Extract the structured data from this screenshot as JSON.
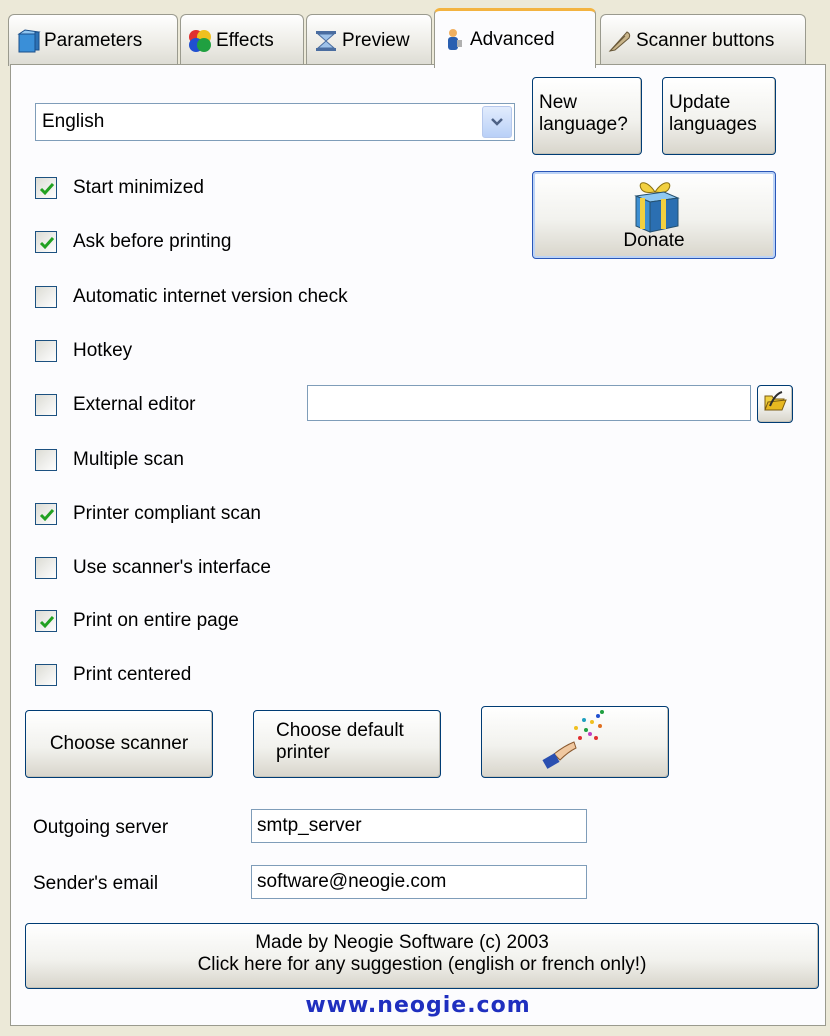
{
  "tabs": [
    {
      "label": "Parameters",
      "icon": "document-icon",
      "active": false
    },
    {
      "label": "Effects",
      "icon": "color-wheel-icon",
      "active": false
    },
    {
      "label": "Preview",
      "icon": "hourglass-icon",
      "active": false
    },
    {
      "label": "Advanced",
      "icon": "person-icon",
      "active": true
    },
    {
      "label": "Scanner buttons",
      "icon": "feather-pen-icon",
      "active": false
    }
  ],
  "language": {
    "selected": "English"
  },
  "buttons": {
    "new_language_line1": "New",
    "new_language_line2": "language?",
    "update_languages_line1": "Update",
    "update_languages_line2": "languages",
    "donate": "Donate",
    "choose_scanner": "Choose scanner",
    "choose_printer_line1": "Choose default",
    "choose_printer_line2": "printer",
    "credits_line1": "Made by Neogie Software (c) 2003",
    "credits_line2": "Click here for any suggestion (english or french only!)"
  },
  "options": [
    {
      "label": "Start minimized",
      "checked": true
    },
    {
      "label": "Ask before printing",
      "checked": true
    },
    {
      "label": "Automatic internet version check",
      "checked": false
    },
    {
      "label": "Hotkey",
      "checked": false
    },
    {
      "label": "External editor",
      "checked": false
    },
    {
      "label": "Multiple scan",
      "checked": false
    },
    {
      "label": "Printer compliant scan",
      "checked": true
    },
    {
      "label": "Use scanner's interface",
      "checked": false
    },
    {
      "label": "Print on entire page",
      "checked": true
    },
    {
      "label": "Print centered",
      "checked": false
    }
  ],
  "external_editor": {
    "value": ""
  },
  "email": {
    "server_label": "Outgoing server",
    "server_value": "smtp_server",
    "sender_label": "Sender's email",
    "sender_value": "software@neogie.com"
  },
  "footer": {
    "url": "www.neogie.com"
  },
  "colors": {
    "link": "#1f2fbf",
    "check": "#21a121",
    "accent_tab": "#f3b340"
  }
}
